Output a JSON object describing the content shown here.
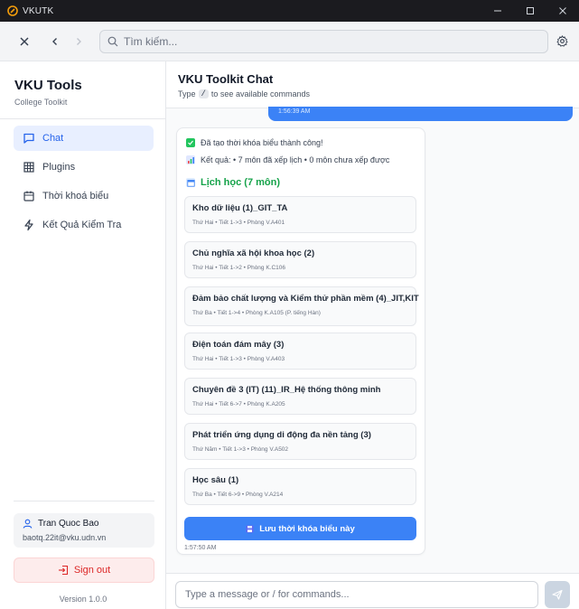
{
  "window": {
    "app_name": "VKUTK"
  },
  "browser": {
    "search_placeholder": "Tìm kiếm..."
  },
  "sidebar": {
    "title": "VKU Tools",
    "subtitle": "College Toolkit",
    "items": [
      {
        "label": "Chat",
        "icon": "chat-icon",
        "active": true
      },
      {
        "label": "Plugins",
        "icon": "grid-icon",
        "active": false
      },
      {
        "label": "Thời khoá biểu",
        "icon": "calendar-icon",
        "active": false
      },
      {
        "label": "Kết Quả Kiểm Tra",
        "icon": "lightning-icon",
        "active": false
      }
    ],
    "user": {
      "name": "Tran Quoc Bao",
      "email": "baotq.22it@vku.udn.vn"
    },
    "signout_label": "Sign out",
    "version": "Version 1.0.0"
  },
  "chat": {
    "title": "VKU Toolkit Chat",
    "subtitle_before": "Type",
    "subtitle_key": "/",
    "subtitle_after": "to see available commands",
    "user_message_time": "1:56:39 AM",
    "bot": {
      "line1": "Đã tạo thời khóa biểu thành công!",
      "line2": "Kết quả: • 7 môn đã xếp lịch • 0 môn chưa xếp được",
      "schedule_title": "Lịch học (7 môn)",
      "courses": [
        {
          "name": "Kho dữ liệu (1)_GIT_TA",
          "meta": "Thứ Hai • Tiết 1->3 • Phòng V.A401"
        },
        {
          "name": "Chủ nghĩa xã hội khoa học (2)",
          "meta": "Thứ Hai • Tiết 1->2 • Phòng K.C106"
        },
        {
          "name": "Đảm bảo chất lượng và Kiểm thử phần mềm (4)_JIT,KIT",
          "meta": "Thứ Ba • Tiết 1->4 • Phòng K.A105 (P. tiếng Hàn)"
        },
        {
          "name": "Điện toán đám mây (3)",
          "meta": "Thứ Hai • Tiết 1->3 • Phòng V.A403"
        },
        {
          "name": "Chuyên đề 3 (IT) (11)_IR_Hệ thống thông minh",
          "meta": "Thứ Hai • Tiết 6->7 • Phòng K.A205"
        },
        {
          "name": "Phát triển ứng dụng di động đa nền tảng (3)",
          "meta": "Thứ Năm • Tiết 1->3 • Phòng V.A502"
        },
        {
          "name": "Học sâu (1)",
          "meta": "Thứ Ba • Tiết 6->9 • Phòng V.A214"
        }
      ],
      "save_label": "Lưu thời khóa biểu này",
      "time": "1:57:50 AM"
    },
    "input_placeholder": "Type a message or / for commands..."
  },
  "colors": {
    "accent": "#3b82f6",
    "success": "#16a34a",
    "danger": "#dc2626"
  }
}
